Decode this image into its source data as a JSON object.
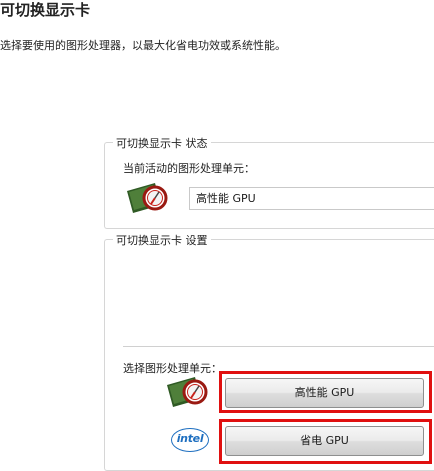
{
  "page": {
    "title": "可切换显示卡",
    "description": "选择要使用的图形处理器，以最大化省电功效或系统性能。"
  },
  "status_group": {
    "legend": "可切换显示卡 状态",
    "current_label": "当前活动的图形处理单元：",
    "current_value": "高性能 GPU",
    "icon": "amd-gpu-icon"
  },
  "settings_group": {
    "legend": "可切换显示卡 设置",
    "select_label": "选择图形处理单元：",
    "performance_button_label": "高性能 GPU",
    "power_saving_button_label": "省电 GPU",
    "amd_icon": "amd-gpu-icon",
    "intel_logo_text": "intel"
  },
  "colors": {
    "highlight": "#e01010",
    "intel_blue": "#1e6fc0",
    "amd_green": "#2f5a24",
    "amd_red": "#c8221b"
  }
}
